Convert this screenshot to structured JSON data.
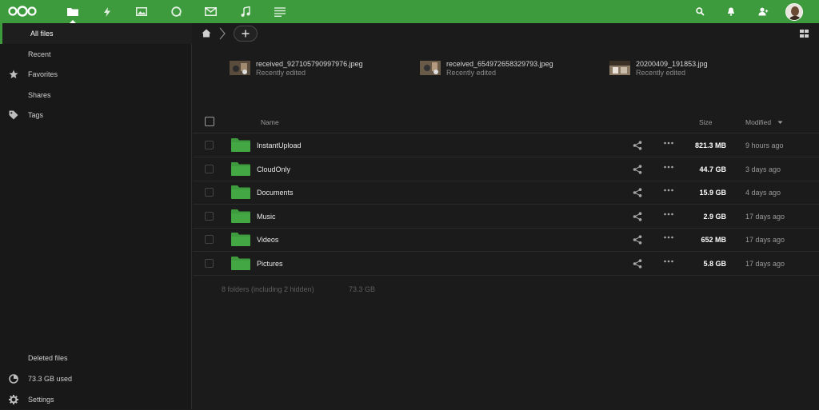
{
  "colors": {
    "accent": "#3d9a3d",
    "background": "#1b1b1b",
    "sidebar": "#181818"
  },
  "topbar": {
    "apps": [
      "files-icon",
      "activity-icon",
      "photos-icon",
      "talk-icon",
      "mail-icon",
      "music-icon",
      "notes-icon"
    ],
    "right": [
      "search-icon",
      "bell-icon",
      "contacts-icon",
      "avatar"
    ]
  },
  "sidebar": {
    "items": [
      {
        "label": "All files",
        "icon": ""
      },
      {
        "label": "Recent",
        "icon": ""
      },
      {
        "label": "Favorites",
        "icon": "star-icon"
      },
      {
        "label": "Shares",
        "icon": ""
      },
      {
        "label": "Tags",
        "icon": "tag-icon"
      }
    ],
    "bottom": [
      {
        "label": "Deleted files",
        "icon": ""
      },
      {
        "label": "73.3 GB used",
        "icon": "pie-icon"
      },
      {
        "label": "Settings",
        "icon": "gear-icon"
      }
    ]
  },
  "recent": [
    {
      "name": "received_927105790997976.jpeg",
      "sub": "Recently edited"
    },
    {
      "name": "received_654972658329793.jpeg",
      "sub": "Recently edited"
    },
    {
      "name": "20200409_191853.jpg",
      "sub": "Recently edited"
    }
  ],
  "table": {
    "headers": {
      "name": "Name",
      "size": "Size",
      "modified": "Modified"
    },
    "rows": [
      {
        "name": "InstantUpload",
        "size": "821.3 MB",
        "modified": "9 hours ago"
      },
      {
        "name": "CloudOnly",
        "size": "44.7 GB",
        "modified": "3 days ago"
      },
      {
        "name": "Documents",
        "size": "15.9 GB",
        "modified": "4 days ago"
      },
      {
        "name": "Music",
        "size": "2.9 GB",
        "modified": "17 days ago"
      },
      {
        "name": "Videos",
        "size": "652 MB",
        "modified": "17 days ago"
      },
      {
        "name": "Pictures",
        "size": "5.8 GB",
        "modified": "17 days ago"
      }
    ]
  },
  "summary": {
    "folders": "8 folders (including 2 hidden)",
    "total": "73.3 GB"
  }
}
